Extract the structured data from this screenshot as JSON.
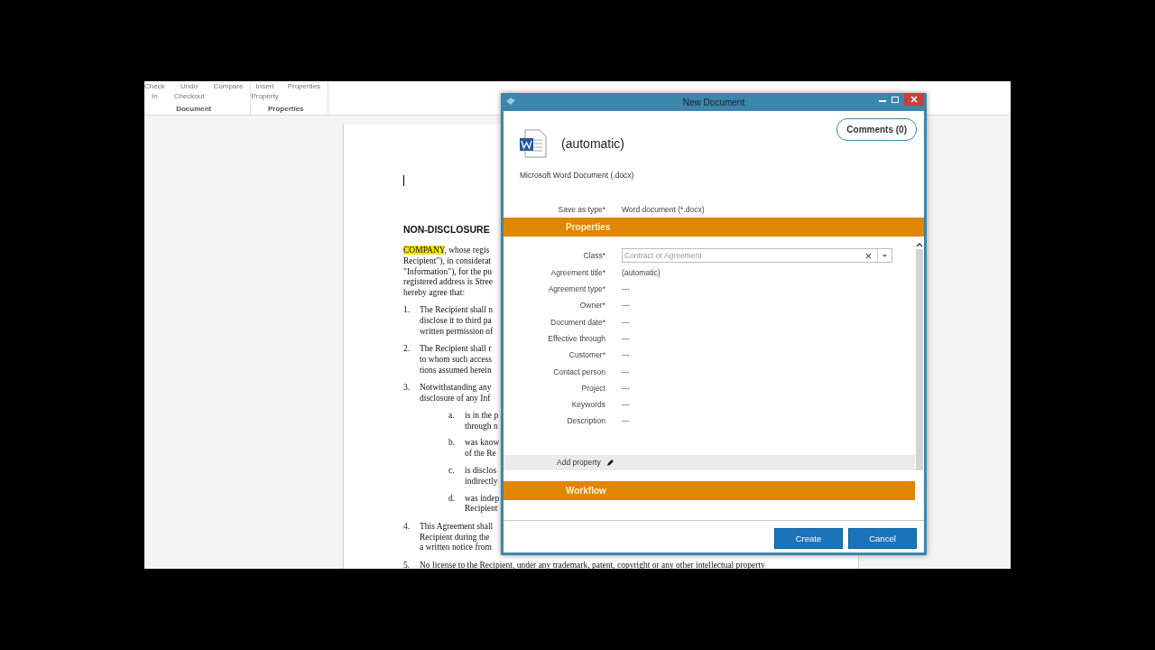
{
  "ribbon": {
    "groups": [
      {
        "label": "Document",
        "buttons": [
          {
            "lines": [
              "Check",
              "In"
            ]
          },
          {
            "lines": [
              "Undo",
              "Checkout"
            ]
          },
          {
            "lines": [
              "Compare"
            ]
          }
        ]
      },
      {
        "label": "Properties",
        "buttons": [
          {
            "lines": [
              "Insert",
              "Property"
            ]
          },
          {
            "lines": [
              "Properties"
            ]
          }
        ]
      }
    ]
  },
  "document": {
    "heading": "NON-DISCLOSURE",
    "intro": [
      {
        "highlight": "COMPANY",
        "text": ", whose regis"
      },
      {
        "text": "Recipient\"), in considerat"
      },
      {
        "text": "\"Information\"), for the pu"
      },
      {
        "text": "registered address is Stree"
      },
      {
        "text": "hereby agree that:"
      }
    ],
    "items": [
      {
        "number": "1.",
        "lines": [
          "The Recipient shall n",
          "disclose it to third pa",
          "written permission of"
        ]
      },
      {
        "number": "2.",
        "lines": [
          "The Recipient shall r",
          "to whom such access",
          "tions assumed herein"
        ]
      },
      {
        "number": "3.",
        "lines": [
          "Notwithstanding any",
          "disclosure of any Inf"
        ],
        "children": [
          {
            "number": "a.",
            "lines": [
              "is in the p",
              "through n"
            ]
          },
          {
            "number": "b.",
            "lines": [
              "was know",
              "of the Re"
            ]
          },
          {
            "number": "c.",
            "lines": [
              "is disclos",
              "indirectly"
            ]
          },
          {
            "number": "d.",
            "lines": [
              "was indep",
              "Recipient"
            ]
          }
        ]
      },
      {
        "number": "4.",
        "lines": [
          "This Agreement shall",
          "Recipient during the",
          "a written notice from"
        ]
      },
      {
        "number": "5.",
        "lines": [
          "No license to the Recipient, under any trademark, patent, copyright or any other intellectual property"
        ]
      }
    ]
  },
  "dialog": {
    "title": "New Document",
    "comments": "Comments (0)",
    "file_name": "(automatic)",
    "file_type": "Microsoft Word Document (.docx)",
    "save_as": {
      "label": "Save as type*",
      "value": "Word document (*.docx)"
    },
    "properties_header": "Properties",
    "fields": [
      {
        "kind": "combobox",
        "label": "Class*",
        "placeholder": "Contract or Agreement"
      },
      {
        "kind": "text",
        "label": "Agreement title*",
        "value": "(automatic)"
      },
      {
        "kind": "text",
        "label": "Agreement type*",
        "value": "---"
      },
      {
        "kind": "text",
        "label": "Owner*",
        "value": "---"
      },
      {
        "kind": "text",
        "label": "Document date*",
        "value": "---"
      },
      {
        "kind": "text",
        "label": "Effective through",
        "value": "---"
      },
      {
        "kind": "text",
        "label": "Customer*",
        "value": "---"
      },
      {
        "kind": "text",
        "label": "Contact person",
        "value": "---"
      },
      {
        "kind": "text",
        "label": "Project",
        "value": "---"
      },
      {
        "kind": "text",
        "label": "Keywords",
        "value": "---"
      },
      {
        "kind": "text",
        "label": "Description",
        "value": "---"
      }
    ],
    "add_property": "Add property",
    "workflow_header": "Workflow",
    "buttons": [
      "Create",
      "Cancel"
    ]
  }
}
